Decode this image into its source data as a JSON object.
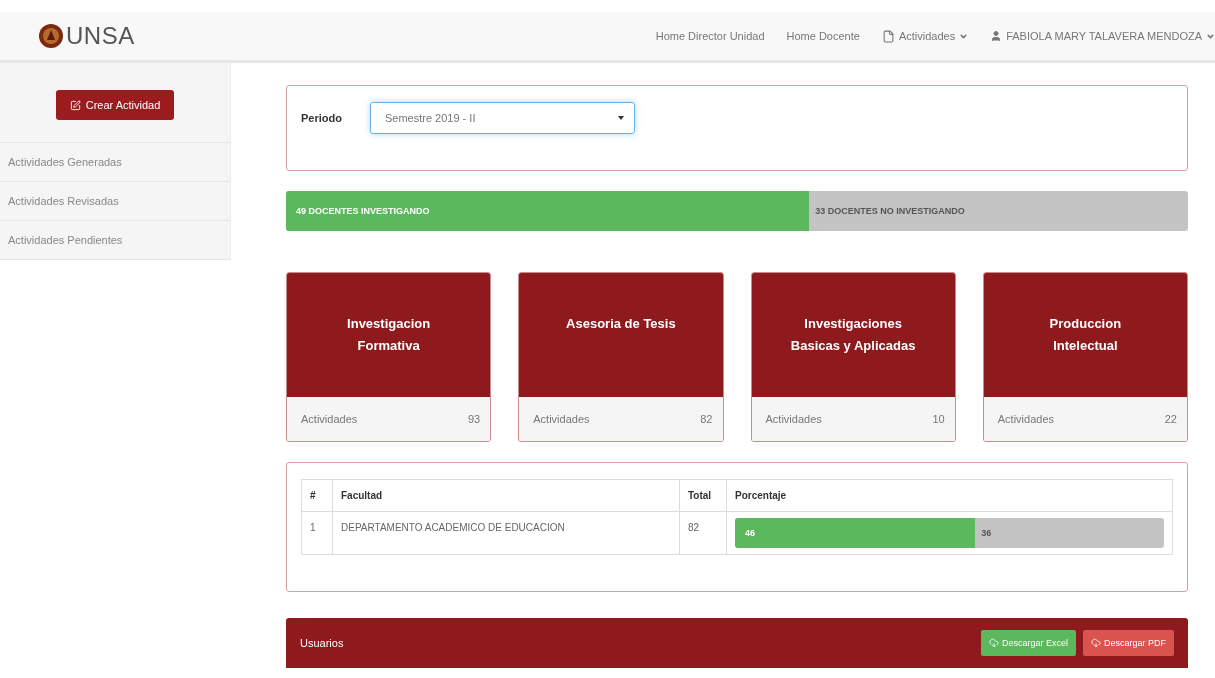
{
  "brand": {
    "name": "UNSA"
  },
  "nav": [
    {
      "label": "Home Director Unidad",
      "kind": "link"
    },
    {
      "label": "Home Docente",
      "kind": "link"
    },
    {
      "label": "Actividades",
      "kind": "menu"
    },
    {
      "label": "FABIOLA MARY TALAVERA MENDOZA",
      "kind": "user"
    }
  ],
  "sidebar": {
    "button": "Crear Actividad",
    "items": [
      "Actividades Generadas",
      "Actividades Revisadas",
      "Actividades Pendientes"
    ]
  },
  "periodo": {
    "label": "Periodo",
    "value": "Semestre 2019 - II"
  },
  "docentes_bar": {
    "level": 0.58,
    "filled_label": "49 DOCENTES INVESTIGANDO",
    "rest_label": "33 DOCENTES NO INVESTIGANDO"
  },
  "cards": [
    {
      "title": "Investigacion Formativa",
      "label": "Actividades",
      "count": "93"
    },
    {
      "title": "Asesoria de Tesis",
      "label": "Actividades",
      "count": "82"
    },
    {
      "title": "Investigaciones Basicas y Aplicadas",
      "label": "Actividades",
      "count": "10"
    },
    {
      "title": "Produccion Intelectual",
      "label": "Actividades",
      "count": "22"
    }
  ],
  "table": {
    "columns": [
      "#",
      "Facultad",
      "Total",
      "Porcentaje"
    ],
    "rows": [
      {
        "index": "1",
        "facultad": "DEPARTAMENTO ACADEMICO DE EDUCACION",
        "total": "82",
        "level": 0.56,
        "filled_label": "46",
        "rest_label": "36"
      }
    ]
  },
  "usuarios": {
    "title": "Usuarios",
    "buttons": [
      {
        "label": "Descargar Excel",
        "kind": "excel"
      },
      {
        "label": "Descargar PDF",
        "kind": "pdf"
      }
    ]
  }
}
